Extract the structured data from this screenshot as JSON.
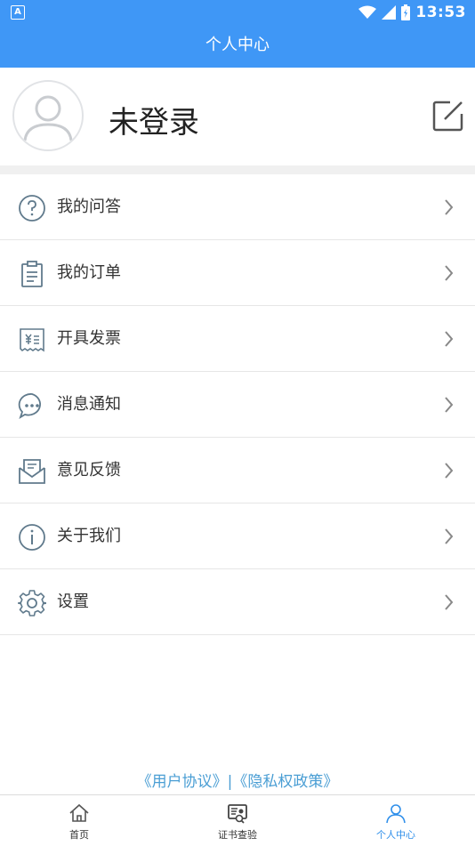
{
  "status_bar": {
    "time": "13:53",
    "indicator": "A"
  },
  "app_bar": {
    "title": "个人中心"
  },
  "profile": {
    "username": "未登录"
  },
  "menu": [
    {
      "label": "我的问答",
      "icon": "question-circle-icon"
    },
    {
      "label": "我的订单",
      "icon": "clipboard-icon"
    },
    {
      "label": "开具发票",
      "icon": "receipt-icon"
    },
    {
      "label": "消息通知",
      "icon": "chat-bubble-icon"
    },
    {
      "label": "意见反馈",
      "icon": "envelope-icon"
    },
    {
      "label": "关于我们",
      "icon": "info-circle-icon"
    },
    {
      "label": "设置",
      "icon": "gear-icon"
    }
  ],
  "footer": {
    "user_agreement": "《用户协议》",
    "separator": "|",
    "privacy_policy": "《隐私权政策》"
  },
  "tabs": [
    {
      "label": "首页",
      "icon": "home-icon",
      "active": false
    },
    {
      "label": "证书查验",
      "icon": "certificate-search-icon",
      "active": false
    },
    {
      "label": "个人中心",
      "icon": "person-icon",
      "active": true
    }
  ],
  "colors": {
    "primary": "#3f97f6",
    "link": "#4a9ed4",
    "icon_gray": "#607a8c",
    "active_tab": "#2f8fea"
  }
}
